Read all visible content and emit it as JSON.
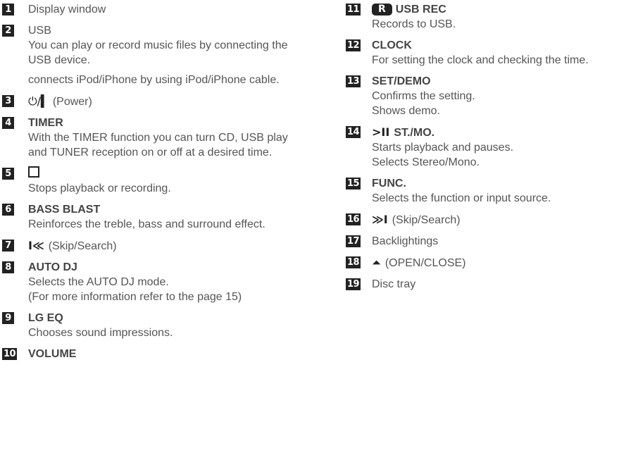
{
  "left_items": [
    {
      "num": "1",
      "title": "Display window"
    },
    {
      "num": "2",
      "title": "USB",
      "desc1": "You can play or record music files by connecting the USB device.",
      "desc2": "connects iPod/iPhone by using iPod/iPhone cable."
    },
    {
      "num": "3",
      "title": "(Power)",
      "power_symbol": "⏻/▍"
    },
    {
      "num": "4",
      "title": "TIMER",
      "desc": "With the TIMER function you can turn CD, USB play and TUNER reception on or off at a desired time."
    },
    {
      "num": "5",
      "desc": "Stops playback or recording."
    },
    {
      "num": "6",
      "title": "BASS BLAST",
      "desc": "Reinforces the treble, bass and surround effect."
    },
    {
      "num": "7",
      "symbol": "I≪",
      "title": "(Skip/Search)"
    },
    {
      "num": "8",
      "title": "AUTO DJ",
      "desc1": "Selects the AUTO DJ mode.",
      "desc2": "(For more information refer to the page 15)"
    },
    {
      "num": "9",
      "title": "LG EQ",
      "desc": "Chooses sound impressions."
    },
    {
      "num": "10",
      "title": "VOLUME"
    }
  ],
  "right_items": [
    {
      "num": "11",
      "rec_icon": "R",
      "title": "USB REC",
      "desc": "Records to USB."
    },
    {
      "num": "12",
      "title": "CLOCK",
      "desc": "For setting the clock and checking the time."
    },
    {
      "num": "13",
      "title": "SET/DEMO",
      "desc1": "Confirms the setting.",
      "desc2": "Shows demo."
    },
    {
      "num": "14",
      "symbol": ">II",
      "title": "ST./MO.",
      "desc1": "Starts playback and pauses.",
      "desc2": "Selects Stereo/Mono."
    },
    {
      "num": "15",
      "title": "FUNC.",
      "desc": "Selects the function or input source."
    },
    {
      "num": "16",
      "symbol": "≫I",
      "title": "(Skip/Search)"
    },
    {
      "num": "17",
      "title": "Backlightings"
    },
    {
      "num": "18",
      "symbol": "⏶",
      "title": "(OPEN/CLOSE)"
    },
    {
      "num": "19",
      "title": "Disc tray"
    }
  ],
  "icons": {
    "stop": "stop-square-icon",
    "power": "power-icon",
    "eject": "eject-icon",
    "rec": "usb-rec-icon"
  }
}
